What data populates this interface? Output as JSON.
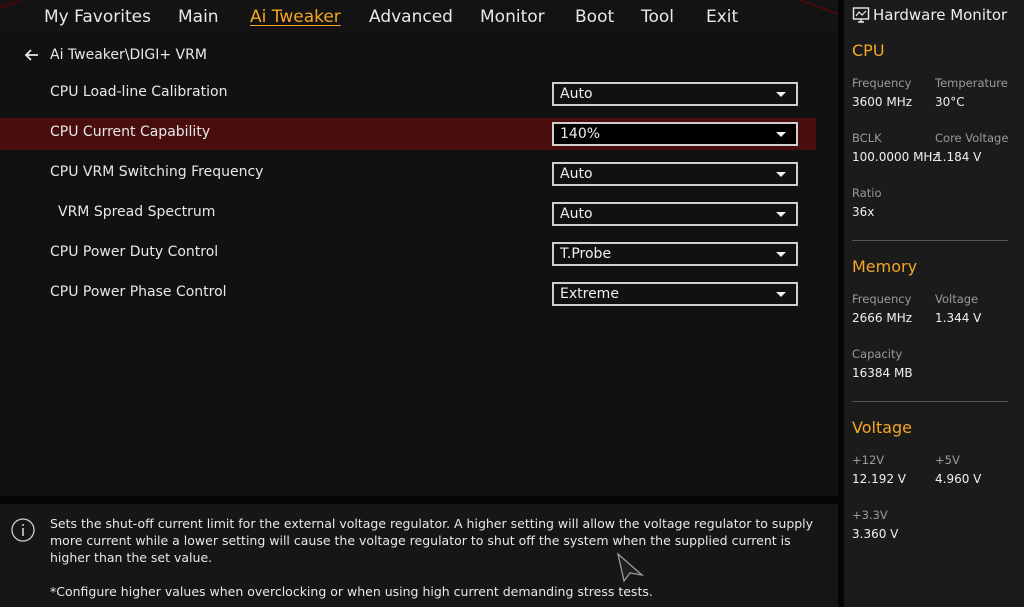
{
  "menu": {
    "items": [
      {
        "label": "My Favorites"
      },
      {
        "label": "Main"
      },
      {
        "label": "Ai Tweaker"
      },
      {
        "label": "Advanced"
      },
      {
        "label": "Monitor"
      },
      {
        "label": "Boot"
      },
      {
        "label": "Tool"
      },
      {
        "label": "Exit"
      }
    ],
    "active": "Ai Tweaker"
  },
  "breadcrumb": "Ai Tweaker\\DIGI+ VRM",
  "settings": [
    {
      "label": "CPU Load-line Calibration",
      "value": "Auto"
    },
    {
      "label": "CPU Current Capability",
      "value": "140%"
    },
    {
      "label": "CPU VRM Switching Frequency",
      "value": "Auto"
    },
    {
      "label": "VRM Spread Spectrum",
      "value": "Auto"
    },
    {
      "label": "CPU Power Duty Control",
      "value": "T.Probe"
    },
    {
      "label": "CPU Power Phase Control",
      "value": "Extreme"
    }
  ],
  "selected_setting": "CPU Current Capability",
  "help": {
    "text": "Sets the shut-off current limit for the external voltage regulator. A higher setting will allow the voltage regulator to supply more current while a lower setting will cause the voltage regulator to shut off the system when the supplied current is higher than the set value.",
    "note": "*Configure higher values when overclocking or when using high current demanding stress tests."
  },
  "hw_monitor": {
    "title": "Hardware Monitor",
    "cpu": {
      "heading": "CPU",
      "frequency_label": "Frequency",
      "frequency": "3600 MHz",
      "temperature_label": "Temperature",
      "temperature": "30°C",
      "bclk_label": "BCLK",
      "bclk": "100.0000 MHz",
      "core_voltage_label": "Core Voltage",
      "core_voltage": "1.184 V",
      "ratio_label": "Ratio",
      "ratio": "36x"
    },
    "memory": {
      "heading": "Memory",
      "frequency_label": "Frequency",
      "frequency": "2666 MHz",
      "voltage_label": "Voltage",
      "voltage": "1.344 V",
      "capacity_label": "Capacity",
      "capacity": "16384 MB"
    },
    "voltage": {
      "heading": "Voltage",
      "v12_label": "+12V",
      "v12": "12.192 V",
      "v5_label": "+5V",
      "v5": "4.960 V",
      "v33_label": "+3.3V",
      "v33": "3.360 V"
    }
  },
  "colors": {
    "accent": "#f5a623",
    "selected_row": "#4a0d0d",
    "background": "#111111"
  }
}
